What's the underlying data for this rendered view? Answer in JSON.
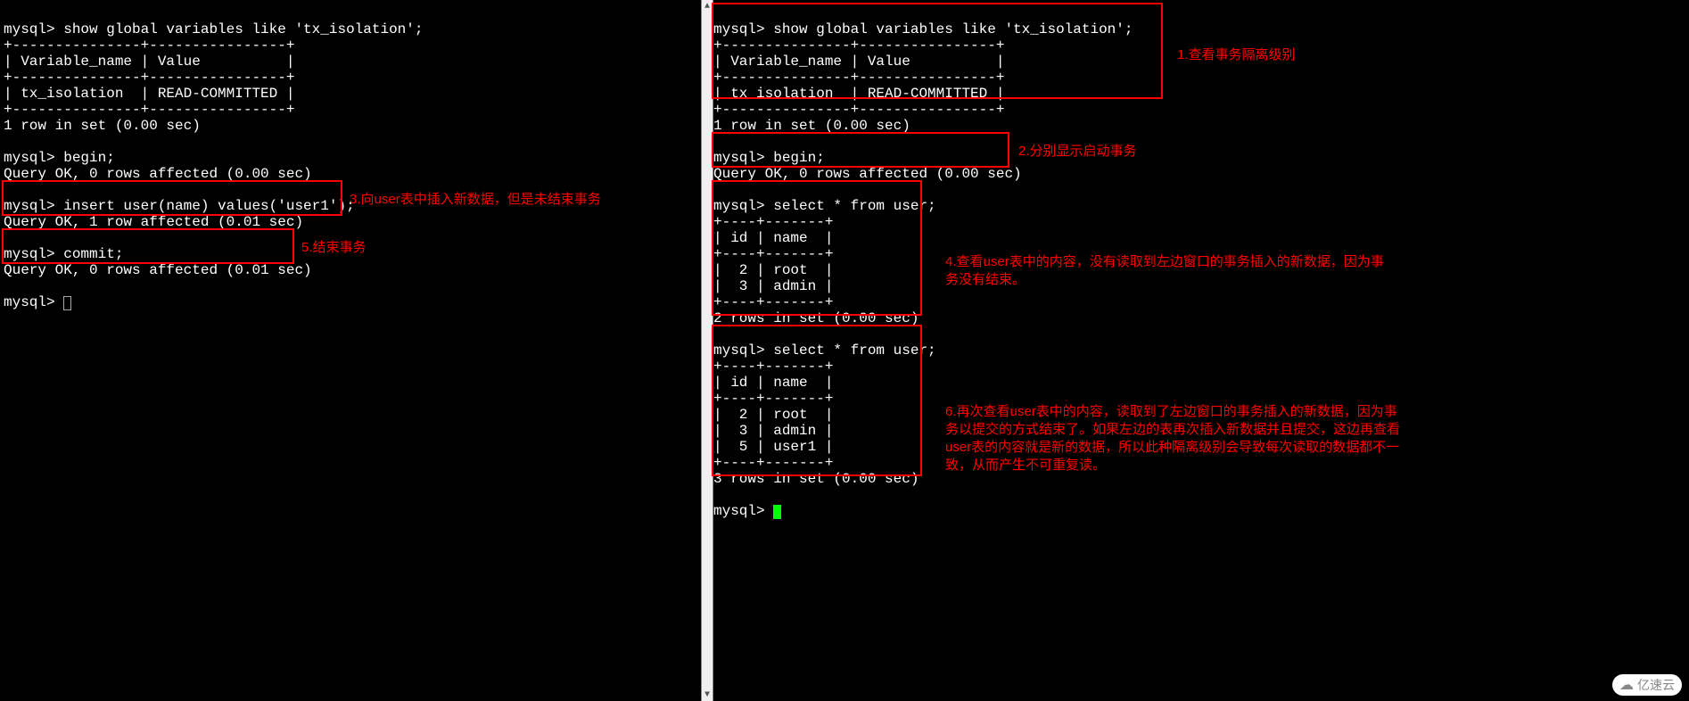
{
  "left": {
    "block1": "mysql> show global variables like 'tx_isolation';\n+---------------+----------------+\n| Variable_name | Value          |\n+---------------+----------------+\n| tx_isolation  | READ-COMMITTED |\n+---------------+----------------+\n1 row in set (0.00 sec)",
    "block2": "mysql> begin;\nQuery OK, 0 rows affected (0.00 sec)",
    "block3": "mysql> insert user(name) values('user1');\nQuery OK, 1 row affected (0.01 sec)",
    "block4": "mysql> commit;\nQuery OK, 0 rows affected (0.01 sec)",
    "prompt": "mysql> "
  },
  "right": {
    "block1": "mysql> show global variables like 'tx_isolation';\n+---------------+----------------+\n| Variable_name | Value          |\n+---------------+----------------+\n| tx_isolation  | READ-COMMITTED |\n+---------------+----------------+\n1 row in set (0.00 sec)",
    "block2": "mysql> begin;\nQuery OK, 0 rows affected (0.00 sec)",
    "block3": "mysql> select * from user;\n+----+-------+\n| id | name  |\n+----+-------+\n|  2 | root  |\n|  3 | admin |\n+----+-------+\n2 rows in set (0.00 sec)",
    "block4": "mysql> select * from user;\n+----+-------+\n| id | name  |\n+----+-------+\n|  2 | root  |\n|  3 | admin |\n|  5 | user1 |\n+----+-------+\n3 rows in set (0.00 sec)",
    "prompt": "mysql> "
  },
  "annotations": {
    "a1": "1.查看事务隔离级别",
    "a2": "2.分别显示启动事务",
    "a3": "3.向user表中插入新数据，但是未结束事务",
    "a4": "4.查看user表中的内容，没有读取到左边窗口的事务插入的新数据，因为事务没有结束。",
    "a5": "5.结束事务",
    "a6": "6.再次查看user表中的内容，读取到了左边窗口的事务插入的新数据，因为事务以提交的方式结束了。如果左边的表再次插入新数据并且提交，这边再查看user表的内容就是新的数据，所以此种隔离级别会导致每次读取的数据都不一致，从而产生不可重复读。"
  },
  "watermark": "亿速云"
}
